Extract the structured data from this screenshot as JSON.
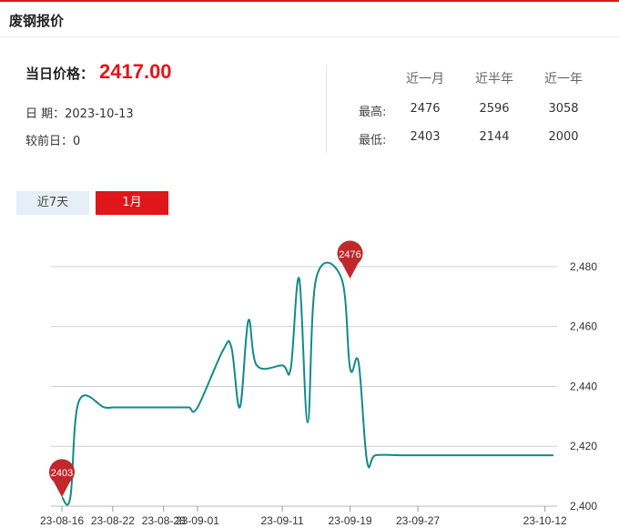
{
  "header": {
    "title": "废钢报价"
  },
  "price": {
    "label": "当日价格：",
    "value": "2417.00"
  },
  "info": {
    "date_label": "日 期：",
    "date_value": "2023-10-13",
    "change_label": "较前日：",
    "change_value": "0"
  },
  "stats": {
    "columns": [
      "近一月",
      "近半年",
      "近一年"
    ],
    "rows": [
      {
        "label": "最高:",
        "values": [
          "2476",
          "2596",
          "3058"
        ]
      },
      {
        "label": "最低:",
        "values": [
          "2403",
          "2144",
          "2000"
        ]
      }
    ]
  },
  "tabs": [
    {
      "label": "近7天",
      "active": false
    },
    {
      "label": "1月",
      "active": true
    }
  ],
  "colors": {
    "accent": "#e0161b",
    "line": "#128a8a",
    "marker": "#c0282b",
    "grid": "#d0d0d0"
  },
  "chart_data": {
    "type": "line",
    "title": "",
    "xlabel": "",
    "ylabel": "",
    "ylim": [
      2400,
      2490
    ],
    "yticks": [
      2400,
      2420,
      2440,
      2460,
      2480
    ],
    "ytick_labels": [
      "2,400",
      "2,420",
      "2,440",
      "2,460",
      "2,480"
    ],
    "x_tick_labels": [
      "23-08-16",
      "23-08-22",
      "23-08-28",
      "23-09-01",
      "23-09-11",
      "23-09-19",
      "23-09-27",
      "23-10-12"
    ],
    "x": [
      "23-08-16",
      "23-08-17",
      "23-08-18",
      "23-08-21",
      "23-08-22",
      "23-08-23",
      "23-08-24",
      "23-08-25",
      "23-08-28",
      "23-08-29",
      "23-08-30",
      "23-08-31",
      "23-09-01",
      "23-09-04",
      "23-09-05",
      "23-09-06",
      "23-09-07",
      "23-09-08",
      "23-09-11",
      "23-09-12",
      "23-09-13",
      "23-09-14",
      "23-09-15",
      "23-09-18",
      "23-09-19",
      "23-09-20",
      "23-09-21",
      "23-09-22",
      "23-09-25",
      "23-09-26",
      "23-09-27",
      "23-09-28",
      "23-10-09",
      "23-10-10",
      "23-10-11",
      "23-10-12",
      "23-10-13"
    ],
    "series": [
      {
        "name": "",
        "values": [
          2403,
          2403,
          2435,
          2433,
          2433,
          2433,
          2433,
          2433,
          2433,
          2433,
          2433,
          2433,
          2433,
          2452,
          2453,
          2433,
          2462,
          2447,
          2447,
          2446,
          2476,
          2428,
          2476,
          2476,
          2446,
          2448,
          2415,
          2417,
          2417,
          2417,
          2417,
          2417,
          2417,
          2417,
          2417,
          2417,
          2417
        ]
      }
    ],
    "annotations": [
      {
        "label": "2403",
        "x": "23-08-16",
        "value": 2403
      },
      {
        "label": "2476",
        "x": "23-09-19",
        "value": 2476
      }
    ],
    "grid": true,
    "legend": "none"
  }
}
